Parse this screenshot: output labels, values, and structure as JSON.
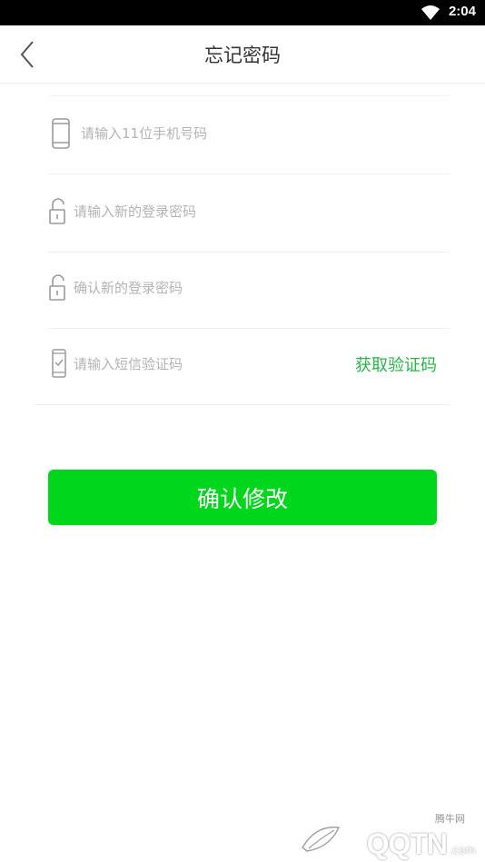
{
  "status_bar": {
    "time": "2:04",
    "wifi_icon": "wifi-icon"
  },
  "header": {
    "title": "忘记密码",
    "back_icon": "chevron-left-icon"
  },
  "form": {
    "phone": {
      "placeholder": "请输入11位手机号码",
      "value": "",
      "icon": "phone-icon"
    },
    "new_password": {
      "placeholder": "请输入新的登录密码",
      "value": "",
      "icon": "lock-icon"
    },
    "confirm_password": {
      "placeholder": "确认新的登录密码",
      "value": "",
      "icon": "lock-icon"
    },
    "sms_code": {
      "placeholder": "请输入短信验证码",
      "value": "",
      "icon": "phone-check-icon"
    },
    "get_code_label": "获取验证码"
  },
  "confirm_button": {
    "label": "确认修改"
  },
  "watermark": {
    "brand": "QQTN",
    "tag": "腾牛网",
    "suffix": ".com"
  },
  "colors": {
    "accent_green": "#00d61c",
    "link_green": "#26b64a",
    "placeholder": "#b3b3b3",
    "title": "#333333"
  }
}
